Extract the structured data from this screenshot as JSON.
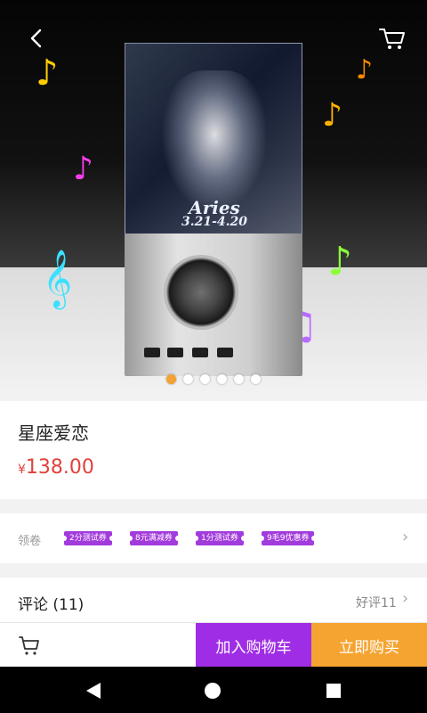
{
  "product": {
    "name": "星座爱恋",
    "currency_symbol": "¥",
    "price": "138.00",
    "image_engraving_title": "Aries",
    "image_engraving_dates": "3.21-4.20",
    "image_count": 6,
    "active_image_index": 0
  },
  "coupons": {
    "label": "领卷",
    "items": [
      {
        "text": "2分测试券"
      },
      {
        "text": "8元满减券"
      },
      {
        "text": "1分测试券"
      },
      {
        "text": "9毛9优惠券"
      }
    ]
  },
  "reviews": {
    "title": "评论 (11)",
    "good_count_label": "好评11"
  },
  "actions": {
    "add_to_cart": "加入购物车",
    "buy_now": "立即购买"
  },
  "colors": {
    "price": "#e2413a",
    "coupon_bg": "#a23bdc",
    "add_to_cart_bg": "#a02de6",
    "buy_now_bg": "#f6a431",
    "active_dot": "#f3a333"
  },
  "icons": {
    "back": "back-arrow-icon",
    "top_cart": "shopping-cart-icon",
    "bottom_cart": "shopping-cart-icon",
    "nav_back": "triangle-back-icon",
    "nav_home": "circle-home-icon",
    "nav_recents": "square-recents-icon"
  }
}
